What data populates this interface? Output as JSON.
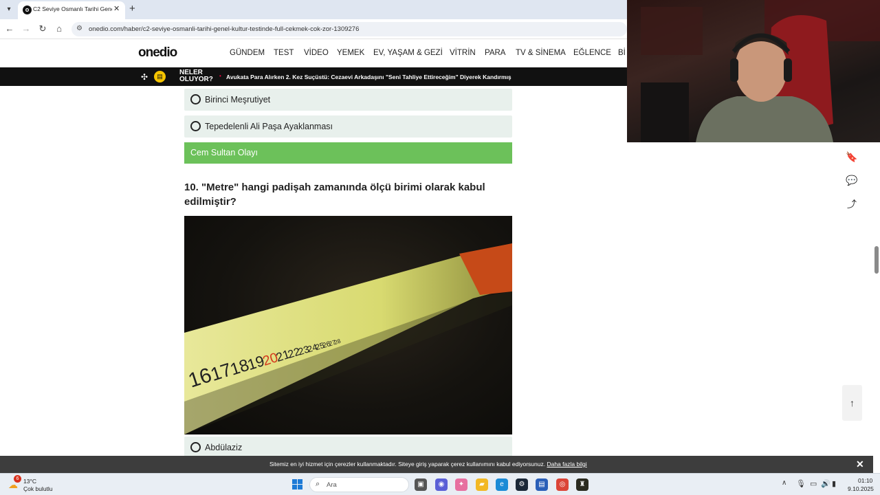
{
  "browser": {
    "tab_title": "C2 Seviye Osmanlı Tarihi Genel",
    "url": "onedio.com/haber/c2-seviye-osmanli-tarihi-genel-kultur-testinde-full-cekmek-cok-zor-1309276"
  },
  "site": {
    "logo": "onedio",
    "nav": [
      "GÜNDEM",
      "TEST",
      "VİDEO",
      "YEMEK",
      "EV, YAŞAM & GEZİ",
      "VİTRİN",
      "PARA",
      "TV & SİNEMA",
      "EĞLENCE",
      "Bİ"
    ],
    "news_label_line1": "NELER",
    "news_label_line2": "OLUYOR?",
    "news_headline": "Avukata Para Alırken 2. Kez Suçüstü: Cezaevi Arkadaşını \"Seni Tahliye Ettireceğim\" Diyerek Kandırmış"
  },
  "quiz": {
    "prev_options": [
      "Birinci Meşrutiyet",
      "Tepedelenli Ali Paşa Ayaklanması"
    ],
    "prev_correct": "Cem Sultan Olayı",
    "question": "10. \"Metre\" hangi padişah zamanında ölçü birimi olarak kabul edilmiştir?",
    "tape_numbers": [
      "16",
      "17",
      "18",
      "19",
      "20",
      "21",
      "22",
      "23",
      "24",
      "25",
      "26",
      "27",
      "28"
    ],
    "options": [
      "Abdülaziz"
    ]
  },
  "cookie": {
    "text": "Sitemiz en iyi hizmet için çerezler kullanmaktadır. Siteye giriş yaparak çerez kullanımını kabul ediyorsunuz.",
    "link": "Daha fazla bilgi"
  },
  "taskbar": {
    "weather_badge": "6",
    "temperature": "13°C",
    "weather": "Çok bulutlu",
    "search_placeholder": "Ara",
    "time": "01:10",
    "date": "9.10.2025"
  },
  "colors": {
    "correct_answer": "#6cc15a",
    "option_bg": "#e8f0ec",
    "news_bar": "#111111"
  }
}
